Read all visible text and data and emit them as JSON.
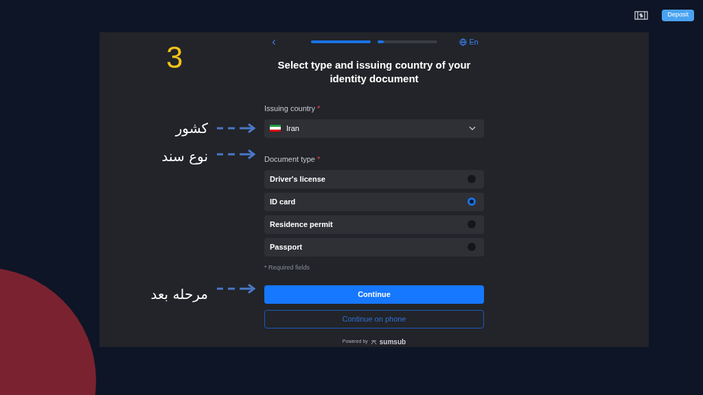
{
  "header": {
    "deposit_button": "Deposit"
  },
  "step_annotation": "3",
  "verification": {
    "back": "‹",
    "progress": [
      {
        "level": 1
      },
      {
        "level": 0.1
      }
    ],
    "language": "En",
    "title": "Select type and issuing country of your identity document",
    "country_label": "Issuing country",
    "country_required": "*",
    "country_value": "Iran",
    "country_annotation": "کشور",
    "document_label": "Document type",
    "document_required": "*",
    "document_annotation": "نوع سند",
    "document_types": [
      {
        "label": "Driver's license",
        "selected": false
      },
      {
        "label": "ID card",
        "selected": true
      },
      {
        "label": "Residence permit",
        "selected": false
      },
      {
        "label": "Passport",
        "selected": false
      }
    ],
    "required_note": "* Required fields",
    "continue_button": "Continue",
    "continue_annotation": "مرحله بعد",
    "phone_button": "Continue on phone",
    "powered_by": "Powered by",
    "brand": "sumsub"
  }
}
